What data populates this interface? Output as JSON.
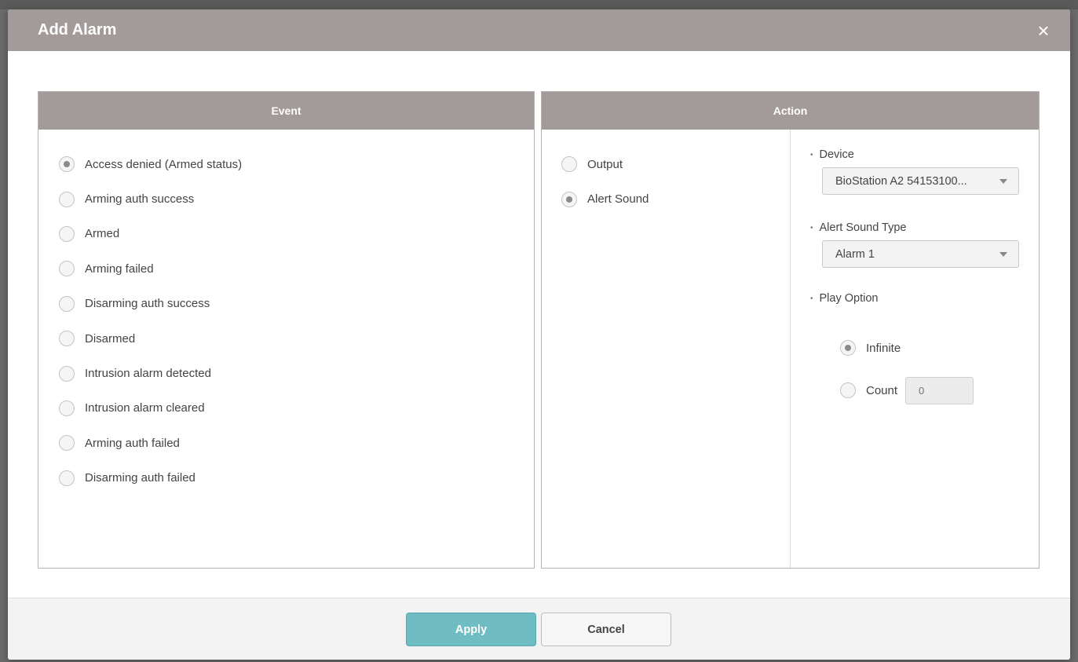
{
  "dialog": {
    "title": "Add Alarm",
    "close_glyph": "×"
  },
  "event_panel": {
    "header": "Event",
    "options": [
      {
        "label": "Access denied (Armed status)",
        "checked": true
      },
      {
        "label": "Arming auth success",
        "checked": false
      },
      {
        "label": "Armed",
        "checked": false
      },
      {
        "label": "Arming failed",
        "checked": false
      },
      {
        "label": "Disarming auth success",
        "checked": false
      },
      {
        "label": "Disarmed",
        "checked": false
      },
      {
        "label": "Intrusion alarm detected",
        "checked": false
      },
      {
        "label": "Intrusion alarm cleared",
        "checked": false
      },
      {
        "label": "Arming auth failed",
        "checked": false
      },
      {
        "label": "Disarming auth failed",
        "checked": false
      }
    ]
  },
  "action_panel": {
    "header": "Action",
    "options": [
      {
        "label": "Output",
        "checked": false
      },
      {
        "label": "Alert Sound",
        "checked": true
      }
    ],
    "device": {
      "label": "Device",
      "value": "BioStation A2 54153100..."
    },
    "alert_sound_type": {
      "label": "Alert Sound Type",
      "value": "Alarm 1"
    },
    "play_option": {
      "label": "Play Option",
      "infinite_label": "Infinite",
      "infinite_checked": true,
      "count_label": "Count",
      "count_checked": false,
      "count_placeholder": "0"
    }
  },
  "footer": {
    "apply_label": "Apply",
    "cancel_label": "Cancel"
  },
  "colors": {
    "header_bg": "#a39a9a",
    "apply_bg": "#6fbdc2"
  }
}
